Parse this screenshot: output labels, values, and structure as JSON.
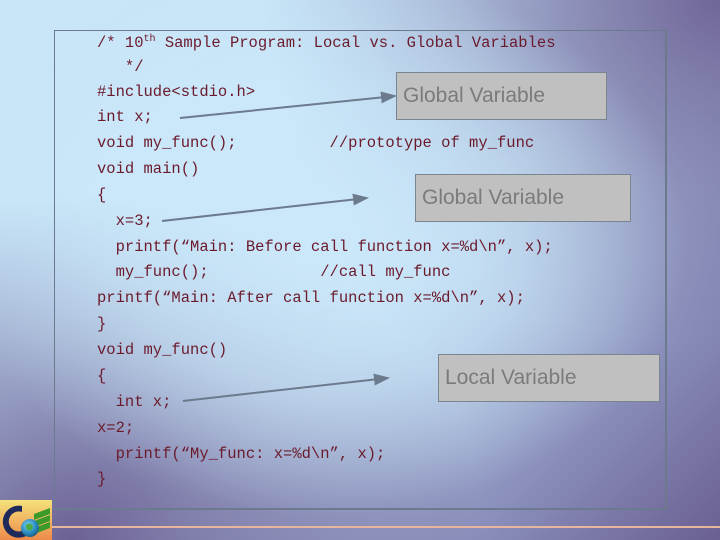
{
  "slide": {
    "code_lines": [
      {
        "id": "comment-1a",
        "pre": "/* 10",
        "sup": "th",
        "post": " Sample Program: Local vs. Global Variables"
      },
      {
        "id": "comment-1b",
        "text": "   */"
      },
      {
        "id": "include",
        "text": "#include<stdio.h>"
      },
      {
        "id": "global-decl",
        "text": "int x;"
      },
      {
        "id": "prototype",
        "text": "void my_func();          //prototype of my_func"
      },
      {
        "id": "main-sig",
        "text": "void main()"
      },
      {
        "id": "main-open",
        "text": "{"
      },
      {
        "id": "assign-3",
        "text": "  x=3;"
      },
      {
        "id": "printf-before",
        "text": "  printf(“Main: Before call function x=%d\\n”, x);"
      },
      {
        "id": "call",
        "text": "  my_func();            //call my_func"
      },
      {
        "id": "printf-after",
        "text": "printf(“Main: After call function x=%d\\n”, x);"
      },
      {
        "id": "main-close",
        "text": "}"
      },
      {
        "id": "func-sig",
        "text": "void my_func()"
      },
      {
        "id": "func-open",
        "text": "{"
      },
      {
        "id": "local-decl",
        "text": "  int x;"
      },
      {
        "id": "assign-2",
        "text": "x=2;"
      },
      {
        "id": "printf-func",
        "text": "  printf(“My_func: x=%d\\n”, x);"
      },
      {
        "id": "func-close",
        "text": "}"
      }
    ],
    "callouts": [
      {
        "label": "Global Variable"
      },
      {
        "label": "Global Variable"
      },
      {
        "label": "Local Variable"
      }
    ],
    "logo": "globe-logo-icon",
    "colors": {
      "code_text": "#6b1a2c",
      "callout_bg": "#c0c0c0",
      "callout_text": "#7b7b7b",
      "arrow": "#6b7a8c",
      "rule": "#e6b59c"
    }
  }
}
